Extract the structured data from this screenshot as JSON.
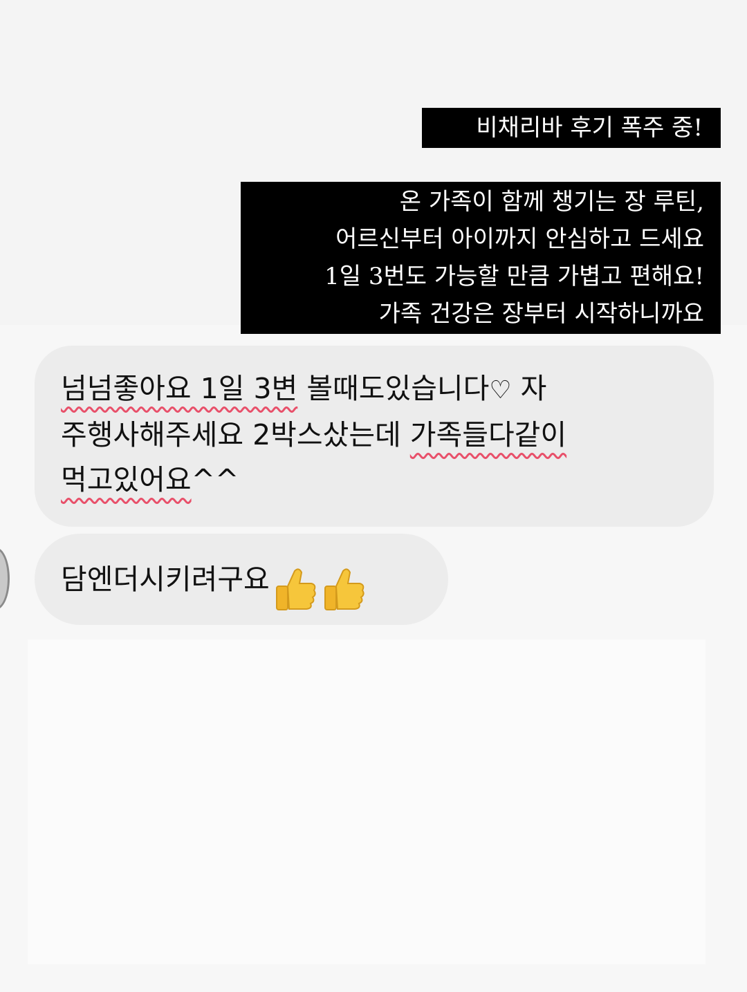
{
  "captions": {
    "headline": "비채리바 후기 폭주 중!",
    "body_lines": [
      "온 가족이 함께 챙기는 장 루틴,",
      "어르신부터 아이까지 안심하고 드세요",
      "1일 3번도 가능할 만큼 가볍고 편해요!",
      "가족 건강은 장부터 시작하니까요"
    ]
  },
  "messages": [
    {
      "segments": {
        "s1": "넘넘좋아요 1일 3변",
        "s2": " 볼때도있습니다",
        "heart": "♡",
        "s3": " 자",
        "s4": "주행사해주세요 2박스샀는데 ",
        "s5": "가족들다같이",
        "s6": "먹고있어요",
        "s7": "^^"
      }
    },
    {
      "text": "담엔더시키려구요",
      "emoji": [
        "thumbs-up",
        "thumbs-up"
      ]
    }
  ],
  "colors": {
    "caption_bg": "#000000",
    "caption_text": "#ffffff",
    "bubble_bg": "#ececec",
    "spellcheck_underline": "#e8506a"
  }
}
